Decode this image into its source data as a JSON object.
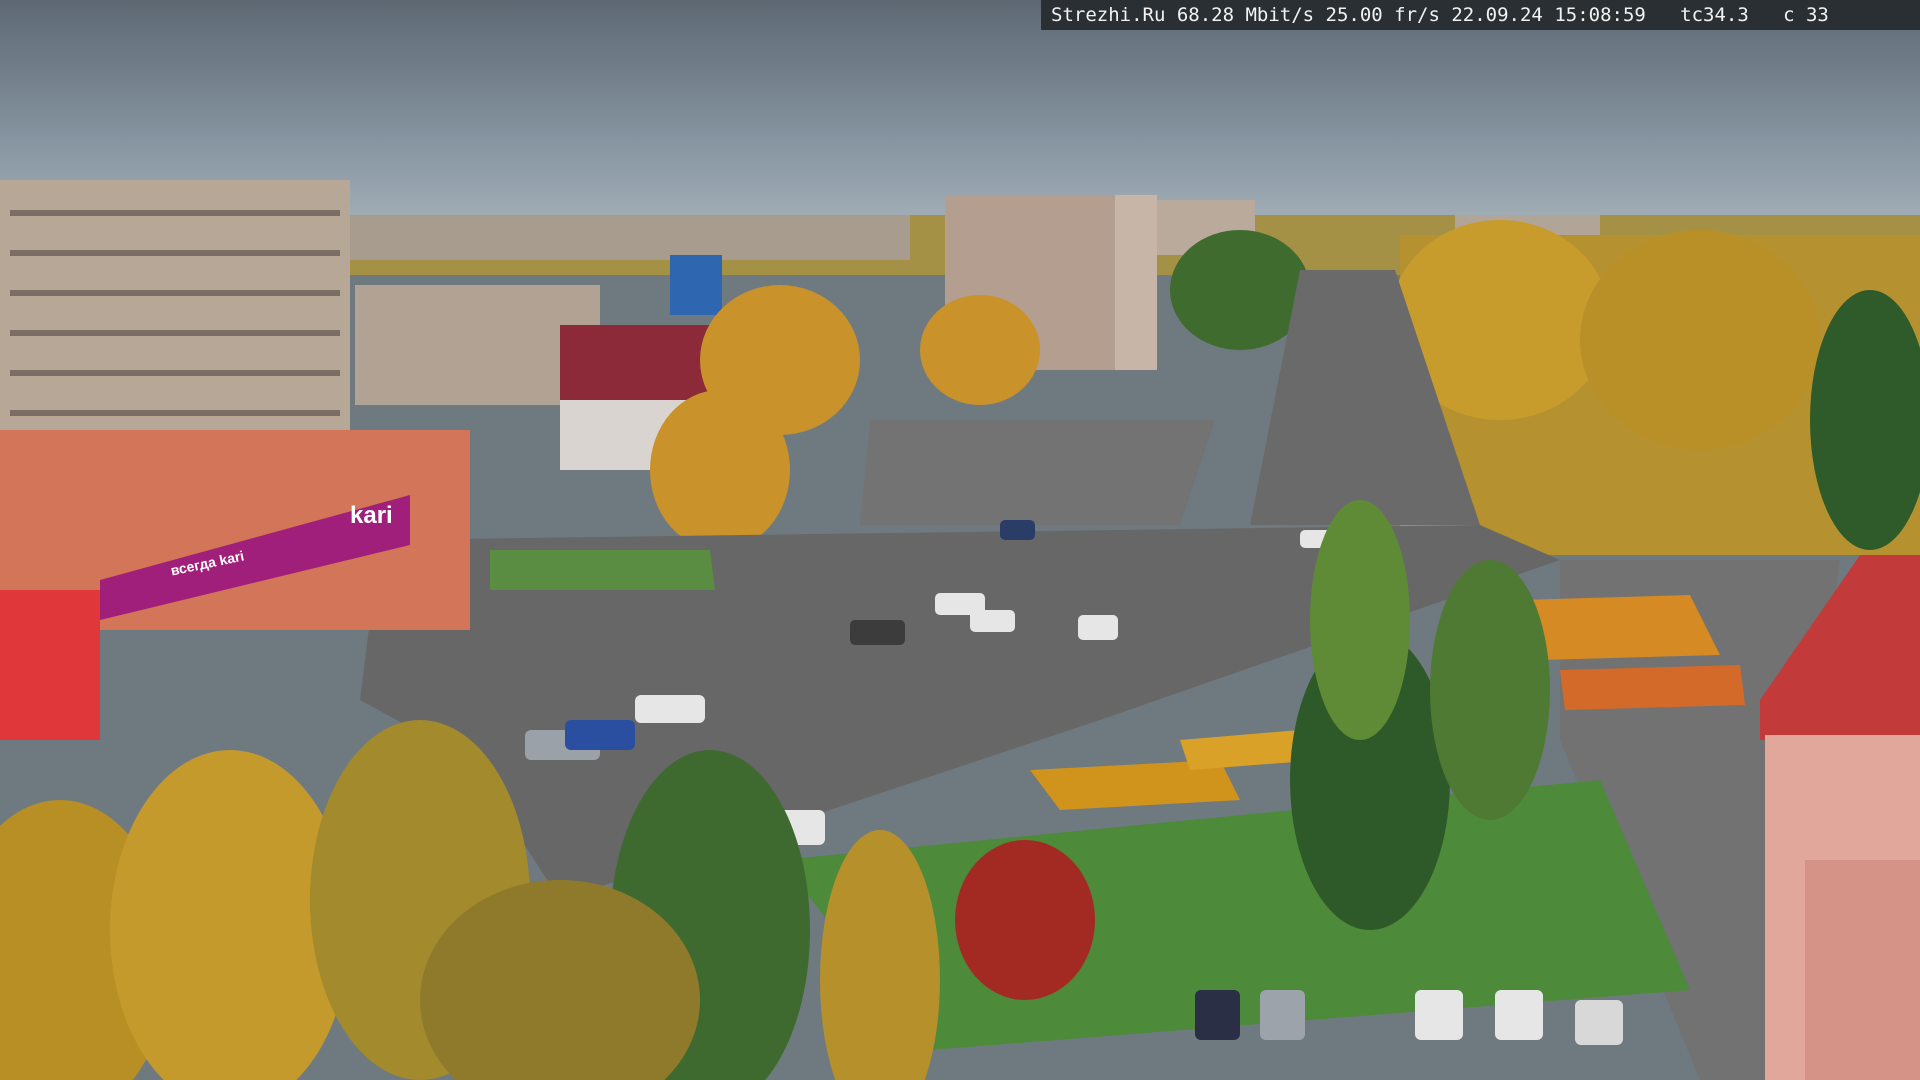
{
  "camera_overlay": {
    "text": "Strezhi.Ru 68.28 Mbit/s 25.00 fr/s 22.09.24 15:08:59   tc34.3   c 33"
  },
  "signage": {
    "store_name": "kari",
    "store_slogan": "всегда kari"
  },
  "colors": {
    "sky": "#7e8b98",
    "asphalt": "#6c6c6c",
    "grass": "#4d8a3a",
    "kari_magenta": "#a01f7a",
    "building_red": "#c33a3a"
  }
}
